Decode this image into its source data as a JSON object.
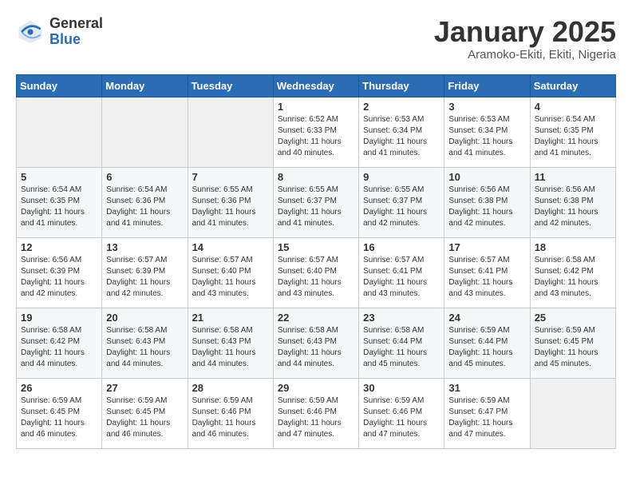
{
  "header": {
    "logo_general": "General",
    "logo_blue": "Blue",
    "month_title": "January 2025",
    "location": "Aramoko-Ekiti, Ekiti, Nigeria"
  },
  "days_of_week": [
    "Sunday",
    "Monday",
    "Tuesday",
    "Wednesday",
    "Thursday",
    "Friday",
    "Saturday"
  ],
  "weeks": [
    [
      {
        "day": "",
        "info": ""
      },
      {
        "day": "",
        "info": ""
      },
      {
        "day": "",
        "info": ""
      },
      {
        "day": "1",
        "info": "Sunrise: 6:52 AM\nSunset: 6:33 PM\nDaylight: 11 hours and 40 minutes."
      },
      {
        "day": "2",
        "info": "Sunrise: 6:53 AM\nSunset: 6:34 PM\nDaylight: 11 hours and 41 minutes."
      },
      {
        "day": "3",
        "info": "Sunrise: 6:53 AM\nSunset: 6:34 PM\nDaylight: 11 hours and 41 minutes."
      },
      {
        "day": "4",
        "info": "Sunrise: 6:54 AM\nSunset: 6:35 PM\nDaylight: 11 hours and 41 minutes."
      }
    ],
    [
      {
        "day": "5",
        "info": "Sunrise: 6:54 AM\nSunset: 6:35 PM\nDaylight: 11 hours and 41 minutes."
      },
      {
        "day": "6",
        "info": "Sunrise: 6:54 AM\nSunset: 6:36 PM\nDaylight: 11 hours and 41 minutes."
      },
      {
        "day": "7",
        "info": "Sunrise: 6:55 AM\nSunset: 6:36 PM\nDaylight: 11 hours and 41 minutes."
      },
      {
        "day": "8",
        "info": "Sunrise: 6:55 AM\nSunset: 6:37 PM\nDaylight: 11 hours and 41 minutes."
      },
      {
        "day": "9",
        "info": "Sunrise: 6:55 AM\nSunset: 6:37 PM\nDaylight: 11 hours and 42 minutes."
      },
      {
        "day": "10",
        "info": "Sunrise: 6:56 AM\nSunset: 6:38 PM\nDaylight: 11 hours and 42 minutes."
      },
      {
        "day": "11",
        "info": "Sunrise: 6:56 AM\nSunset: 6:38 PM\nDaylight: 11 hours and 42 minutes."
      }
    ],
    [
      {
        "day": "12",
        "info": "Sunrise: 6:56 AM\nSunset: 6:39 PM\nDaylight: 11 hours and 42 minutes."
      },
      {
        "day": "13",
        "info": "Sunrise: 6:57 AM\nSunset: 6:39 PM\nDaylight: 11 hours and 42 minutes."
      },
      {
        "day": "14",
        "info": "Sunrise: 6:57 AM\nSunset: 6:40 PM\nDaylight: 11 hours and 43 minutes."
      },
      {
        "day": "15",
        "info": "Sunrise: 6:57 AM\nSunset: 6:40 PM\nDaylight: 11 hours and 43 minutes."
      },
      {
        "day": "16",
        "info": "Sunrise: 6:57 AM\nSunset: 6:41 PM\nDaylight: 11 hours and 43 minutes."
      },
      {
        "day": "17",
        "info": "Sunrise: 6:57 AM\nSunset: 6:41 PM\nDaylight: 11 hours and 43 minutes."
      },
      {
        "day": "18",
        "info": "Sunrise: 6:58 AM\nSunset: 6:42 PM\nDaylight: 11 hours and 43 minutes."
      }
    ],
    [
      {
        "day": "19",
        "info": "Sunrise: 6:58 AM\nSunset: 6:42 PM\nDaylight: 11 hours and 44 minutes."
      },
      {
        "day": "20",
        "info": "Sunrise: 6:58 AM\nSunset: 6:43 PM\nDaylight: 11 hours and 44 minutes."
      },
      {
        "day": "21",
        "info": "Sunrise: 6:58 AM\nSunset: 6:43 PM\nDaylight: 11 hours and 44 minutes."
      },
      {
        "day": "22",
        "info": "Sunrise: 6:58 AM\nSunset: 6:43 PM\nDaylight: 11 hours and 44 minutes."
      },
      {
        "day": "23",
        "info": "Sunrise: 6:58 AM\nSunset: 6:44 PM\nDaylight: 11 hours and 45 minutes."
      },
      {
        "day": "24",
        "info": "Sunrise: 6:59 AM\nSunset: 6:44 PM\nDaylight: 11 hours and 45 minutes."
      },
      {
        "day": "25",
        "info": "Sunrise: 6:59 AM\nSunset: 6:45 PM\nDaylight: 11 hours and 45 minutes."
      }
    ],
    [
      {
        "day": "26",
        "info": "Sunrise: 6:59 AM\nSunset: 6:45 PM\nDaylight: 11 hours and 46 minutes."
      },
      {
        "day": "27",
        "info": "Sunrise: 6:59 AM\nSunset: 6:45 PM\nDaylight: 11 hours and 46 minutes."
      },
      {
        "day": "28",
        "info": "Sunrise: 6:59 AM\nSunset: 6:46 PM\nDaylight: 11 hours and 46 minutes."
      },
      {
        "day": "29",
        "info": "Sunrise: 6:59 AM\nSunset: 6:46 PM\nDaylight: 11 hours and 47 minutes."
      },
      {
        "day": "30",
        "info": "Sunrise: 6:59 AM\nSunset: 6:46 PM\nDaylight: 11 hours and 47 minutes."
      },
      {
        "day": "31",
        "info": "Sunrise: 6:59 AM\nSunset: 6:47 PM\nDaylight: 11 hours and 47 minutes."
      },
      {
        "day": "",
        "info": ""
      }
    ]
  ]
}
